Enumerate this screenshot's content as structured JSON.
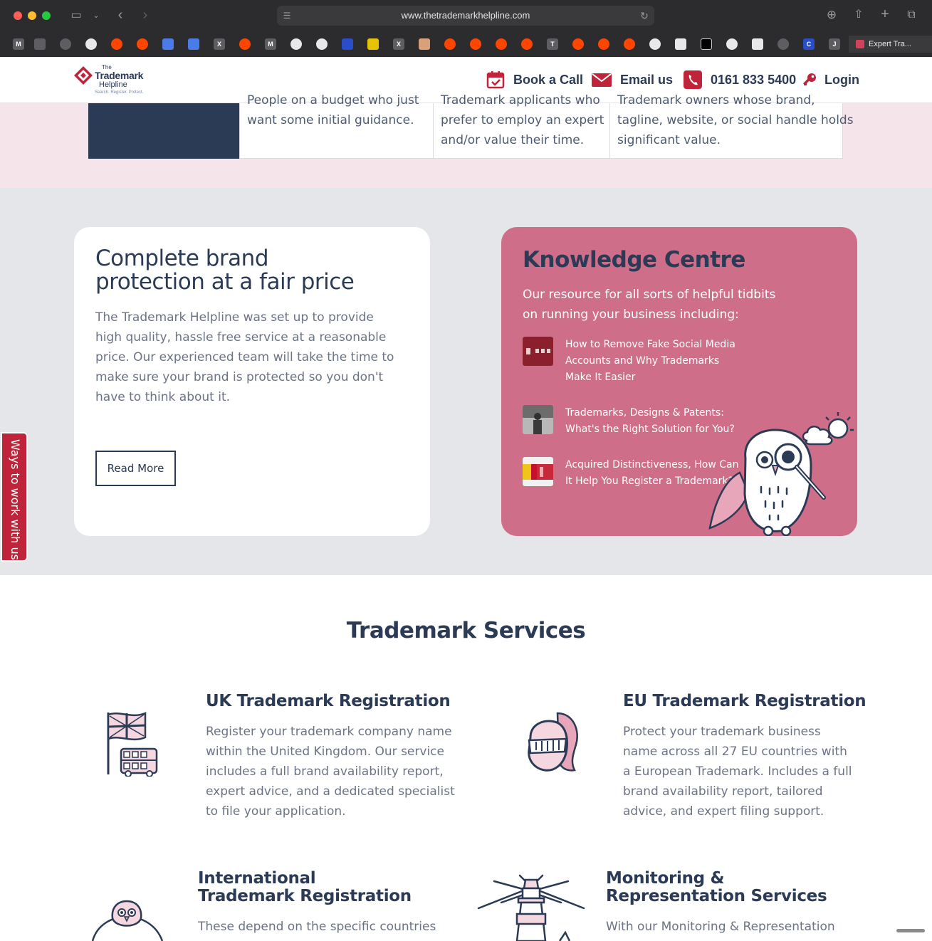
{
  "browser": {
    "url": "www.thetrademarkhelpline.com",
    "active_tab_label": "Expert Tra...",
    "favicons": [
      "M",
      "X",
      "M",
      "X",
      "T",
      "J",
      "C"
    ]
  },
  "header": {
    "logo": {
      "line1": "The",
      "line2": "Trademark",
      "line3": "Helpline",
      "tagline": "Search. Register. Protect."
    },
    "nav": {
      "book_call": "Book a Call",
      "email_us": "Email us",
      "phone": "0161 833 5400",
      "login": "Login"
    }
  },
  "band": {
    "col1": [
      "People on a budget who just",
      "want some initial guidance."
    ],
    "col2": [
      "Trademark applicants who",
      "prefer to employ an expert",
      "and/or value their time."
    ],
    "col3": [
      "Trademark owners whose brand,",
      "tagline, website, or social handle holds",
      "significant value."
    ]
  },
  "brand_card": {
    "title": "Complete brand protection at a fair price",
    "body": "The Trademark Helpline was set up to provide high quality, hassle free service at a reasonable price. Our experienced team will take the time to make sure your brand is protected so you don't have to think about it.",
    "button": "Read More"
  },
  "knowledge": {
    "title": "Knowledge Centre",
    "intro": "Our resource for all sorts of helpful tidbits on running your business including:",
    "articles": [
      {
        "title": "How to Remove Fake Social Media Accounts and Why Trademarks Make It Easier"
      },
      {
        "title": "Trademarks, Designs & Patents: What's the Right Solution for You?"
      },
      {
        "title": "Acquired Distinctiveness, How Can It Help You Register a Trademark?"
      }
    ]
  },
  "side_tab": "Ways to work with us",
  "services": {
    "title": "Trademark Services",
    "items": [
      {
        "title": "UK Trademark Registration",
        "body": "Register your trademark company name within the United Kingdom. Our service includes a full brand availability report, expert advice, and a dedicated specialist to file your application."
      },
      {
        "title": "EU Trademark Registration",
        "body": "Protect your trademark business name across all 27 EU countries with a European Trademark. Includes a full brand availability report, tailored advice, and expert filing support."
      },
      {
        "title": "International Trademark Registration",
        "body": "These depend on the specific countries"
      },
      {
        "title": "Monitoring & Representation Services",
        "body": "With our Monitoring & Representation"
      }
    ]
  },
  "colors": {
    "navy": "#2b3a55",
    "brand_red": "#c0243a",
    "pink_card": "#cf6e88",
    "pink_band": "#f5e4e9",
    "grey_section": "#e4e6e9"
  }
}
